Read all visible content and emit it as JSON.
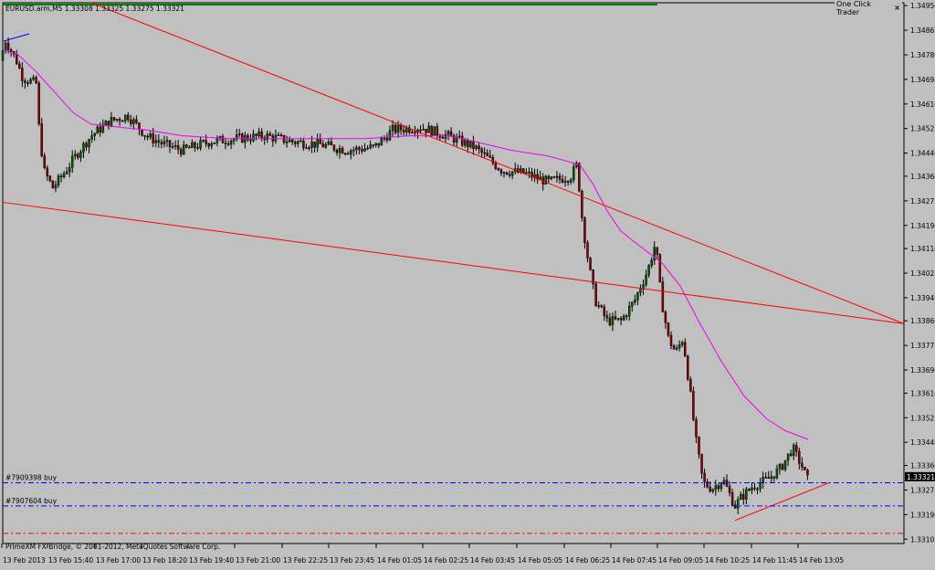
{
  "chart_data": {
    "type": "candlestick",
    "title": "EURUSD.arm,M5  1.33308 1.33325 1.33275 1.33321",
    "symbol": "EURUSD.arm",
    "timeframe": "M5",
    "ohlc_header": [
      "1.33308",
      "1.33325",
      "1.33275",
      "1.33321"
    ],
    "y_ticks": [
      "1.34950",
      "1.34865",
      "1.34780",
      "1.34695",
      "1.34610",
      "1.34525",
      "1.34440",
      "1.34360",
      "1.34275",
      "1.34190",
      "1.34110",
      "1.34025",
      "1.33940",
      "1.33860",
      "1.33775",
      "1.33690",
      "1.33610",
      "1.33525",
      "1.33440",
      "1.33360",
      "1.33275",
      "1.33190",
      "1.33105"
    ],
    "x_ticks": [
      "13 Feb 2013",
      "13 Feb 15:40",
      "13 Feb 17:00",
      "13 Feb 18:20",
      "13 Feb 19:40",
      "13 Feb 21:00",
      "13 Feb 22:25",
      "13 Feb 23:45",
      "14 Feb 01:05",
      "14 Feb 02:25",
      "14 Feb 03:45",
      "14 Feb 05:05",
      "14 Feb 06:25",
      "14 Feb 07:45",
      "14 Feb 09:05",
      "14 Feb 10:25",
      "14 Feb 11:45",
      "14 Feb 13:05"
    ],
    "current_price": "1.33321",
    "ylim": [
      1.3309,
      1.3496
    ],
    "orders": [
      {
        "label": "#7909398 buy",
        "price": 1.333,
        "color": "#0000ff"
      },
      {
        "label": "#7907604 buy",
        "price": 1.3322,
        "color": "#0000ff"
      },
      {
        "label": "",
        "price": 1.33125,
        "color": "#ff0000"
      }
    ],
    "moving_average_color": "#ee00ee",
    "trendline_color": "#ff0000",
    "bull_color": "#006400",
    "bear_color": "#8b0000"
  },
  "panel": {
    "one_click_label": "One Click Trader",
    "close_glyph": "×"
  },
  "footer_text": "PrimeXM FX Bridge, © 2001-2012, MetaQuotes Software Corp."
}
